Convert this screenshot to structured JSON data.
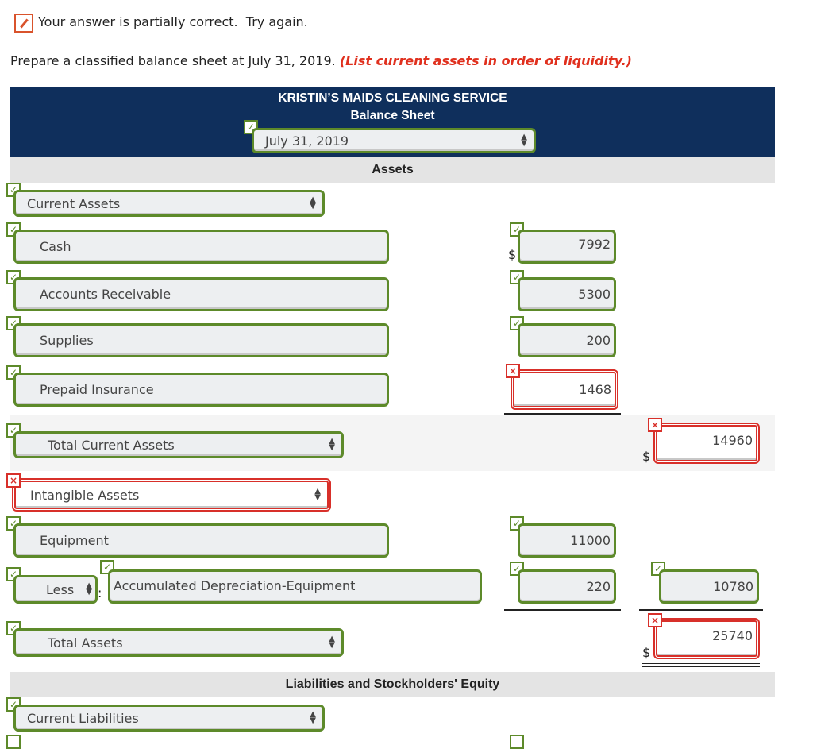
{
  "feedback": {
    "icon": "pencil-icon",
    "text": "Your answer is partially correct.  Try again."
  },
  "instruction": {
    "text": "Prepare a classified balance sheet at July 31, 2019.",
    "note": "(List current assets in order of liquidity.)"
  },
  "header": {
    "company": "KRISTIN’S MAIDS CLEANING SERVICE",
    "statement": "Balance Sheet",
    "date": "July 31, 2019"
  },
  "sections": {
    "assets": "Assets",
    "liabilities": "Liabilities and Stockholders' Equity"
  },
  "rows": {
    "current_assets": "Current Assets",
    "cash": {
      "label": "Cash",
      "amount": "7992",
      "currency": "$"
    },
    "ar": {
      "label": "Accounts Receivable",
      "amount": "5300"
    },
    "supplies": {
      "label": "Supplies",
      "amount": "200"
    },
    "prepaid": {
      "label": "Prepaid Insurance",
      "amount": "1468"
    },
    "total_current": {
      "label": "Total Current Assets",
      "amount": "14960",
      "currency": "$"
    },
    "intangible": "Intangible Assets",
    "equipment": {
      "label": "Equipment",
      "amount": "11000"
    },
    "accum": {
      "prefix": "Less",
      "colon": ":",
      "label": "Accumulated Depreciation-Equipment",
      "amount": "220",
      "net": "10780"
    },
    "total_assets": {
      "label": "Total Assets",
      "amount": "25740",
      "currency": "$"
    },
    "current_liabilities": "Current Liabilities"
  },
  "marks": {
    "correct": "✓",
    "incorrect": "×"
  },
  "colors": {
    "header": "#0f2f5c",
    "correct": "#5d8a2a",
    "incorrect": "#d8302a",
    "note": "#e0301e"
  }
}
